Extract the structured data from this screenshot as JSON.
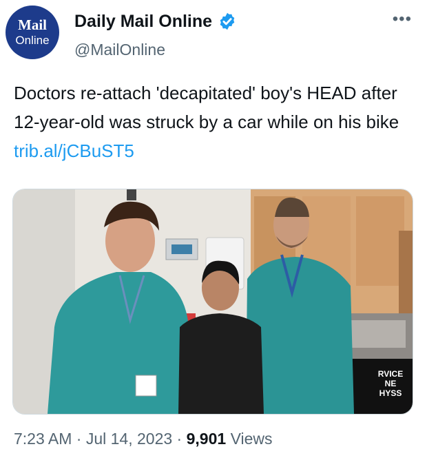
{
  "account": {
    "avatar_line1": "Mail",
    "avatar_line2": "Online",
    "name": "Daily Mail Online",
    "handle": "@MailOnline",
    "more_label": "•••"
  },
  "tweet": {
    "text": "Doctors re-attach 'decapitated' boy's HEAD after 12-year-old was struck by a car while on his bike ",
    "link": "trib.al/jCBuST5"
  },
  "photo": {
    "shirt_text_line1": "RVICE",
    "shirt_text_line2": "NE",
    "shirt_text_line3": "HYSS"
  },
  "meta": {
    "time": "7:23 AM",
    "sep1": " · ",
    "date": "Jul 14, 2023",
    "sep2": " · ",
    "views_count": "9,901",
    "views_label": " Views"
  },
  "colors": {
    "verified": "#1d9bf0",
    "link": "#1d9bf0",
    "avatar_bg": "#1d3b8b",
    "scrubs": "#2e9a9b"
  }
}
